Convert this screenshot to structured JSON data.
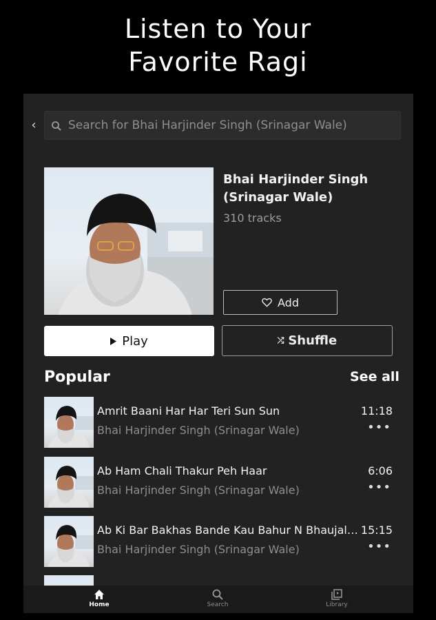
{
  "promo": {
    "headline_line1": "Listen to Your",
    "headline_line2": "Favorite Ragi"
  },
  "search": {
    "placeholder": "Search for Bhai Harjinder Singh (Srinagar Wale)"
  },
  "artist": {
    "name": "Bhai Harjinder Singh (Srinagar Wale)",
    "track_count": "310 tracks",
    "add_label": "Add",
    "play_label": "Play",
    "shuffle_label": "Shuffle"
  },
  "popular": {
    "title": "Popular",
    "see_all_label": "See all",
    "tracks": [
      {
        "title": "Amrit Baani Har Har Teri Sun Sun",
        "artist": "Bhai Harjinder Singh (Srinagar Wale)",
        "duration": "11:18"
      },
      {
        "title": "Ab Ham Chali Thakur Peh Haar",
        "artist": "Bhai Harjinder Singh (Srinagar Wale)",
        "duration": "6:06"
      },
      {
        "title": "Ab Ki Bar Bakhas Bande Kau Bahur N Bhaujal ...",
        "artist": "Bhai Harjinder Singh (Srinagar Wale)",
        "duration": "15:15"
      }
    ]
  },
  "nav": {
    "items": [
      {
        "label": "Home",
        "icon": "home-icon"
      },
      {
        "label": "Search",
        "icon": "search-icon"
      },
      {
        "label": "Library",
        "icon": "library-icon"
      }
    ],
    "active": "Home"
  },
  "colors": {
    "background": "#000000",
    "panel": "#222222",
    "button_primary": "#ffffff",
    "muted_text": "#8e8e8e"
  }
}
